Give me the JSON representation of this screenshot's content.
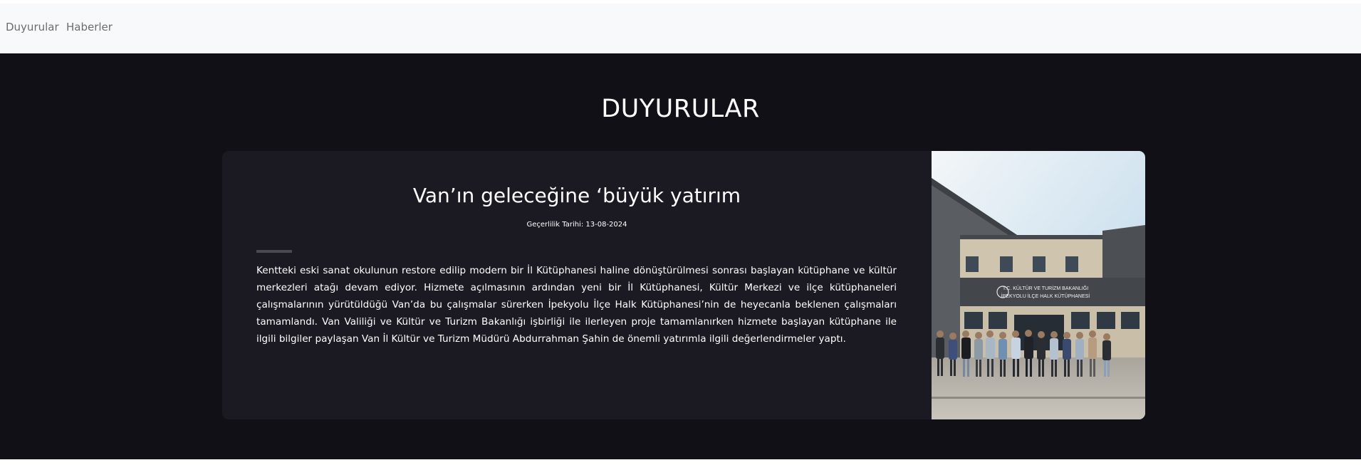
{
  "nav": {
    "items": [
      {
        "label": "Duyurular"
      },
      {
        "label": "Haberler"
      }
    ]
  },
  "section": {
    "title": "DUYURULAR"
  },
  "card": {
    "title": "Van’ın geleceğine ‘büyük yatırım",
    "date": "Geçerlilik Tarihi: 13-08-2024",
    "body": "Kentteki eski sanat okulunun restore edilip modern bir İl Kütüphanesi haline dönüştürülmesi sonrası başlayan kütüphane ve kültür merkezleri atağı devam ediyor. Hizmete açılmasının ardından yeni bir İl Kütüphanesi, Kültür Merkezi ve ilçe kütüphaneleri çalışmalarının yürütüldüğü Van’da bu çalışmalar sürerken İpekyolu İlçe Halk Kütüphanesi’nin de heyecanla beklenen çalışmaları tamamlandı. Van Valiliği ve Kültür ve Turizm Bakanlığı işbirliği ile ilerleyen proje tamamlanırken hizmete başlayan kütüphane ile ilgili bilgiler paylaşan Van İl Kültür ve Turizm Müdürü Abdurrahman Şahin de önemli yatırımla ilgili değerlendirmeler yaptı.",
    "image": {
      "sign_line1": "T.C. KÜLTÜR VE TURİZM BAKANLIĞI",
      "sign_line2": "İPEKYOLU İLÇE HALK KÜTÜPHANESİ"
    }
  }
}
